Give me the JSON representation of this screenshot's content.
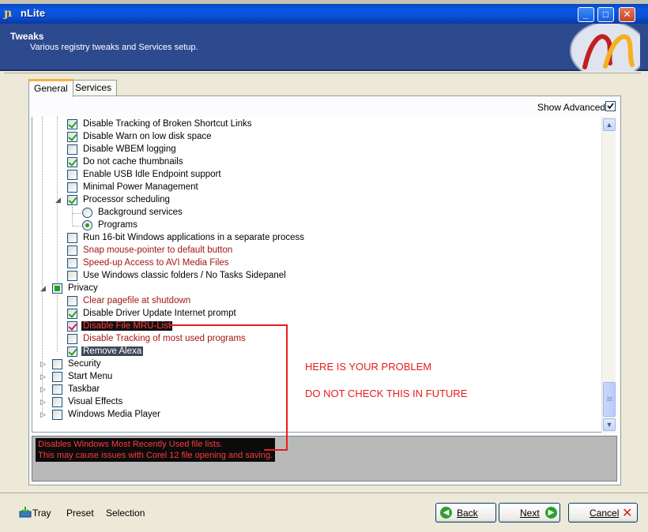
{
  "window": {
    "title": "nLite"
  },
  "header": {
    "title": "Tweaks",
    "subtitle": "Various registry tweaks and Services setup."
  },
  "tabs": [
    {
      "label": "General"
    },
    {
      "label": "Services"
    }
  ],
  "show_advanced": {
    "label": "Show Advanced",
    "checked": true
  },
  "tree_items": [
    {
      "label": "Disable Tracking of Broken Shortcut Links",
      "state": "checked"
    },
    {
      "label": "Disable Warn on low disk space",
      "state": "checked"
    },
    {
      "label": "Disable WBEM logging",
      "state": "unchecked"
    },
    {
      "label": "Do not cache thumbnails",
      "state": "checked"
    },
    {
      "label": "Enable USB Idle Endpoint support",
      "state": "unchecked"
    },
    {
      "label": "Minimal Power Management",
      "state": "unchecked"
    },
    {
      "label": "Processor scheduling",
      "state": "checked"
    },
    {
      "label": "Background services",
      "state": "radio-off"
    },
    {
      "label": "Programs",
      "state": "radio-on"
    },
    {
      "label": "Run 16-bit Windows applications in a separate process",
      "state": "unchecked"
    },
    {
      "label": "Snap mouse-pointer to default button",
      "state": "unchecked"
    },
    {
      "label": "Speed-up Access to AVI Media Files",
      "state": "unchecked"
    },
    {
      "label": "Use Windows classic folders / No Tasks Sidepanel",
      "state": "unchecked"
    },
    {
      "label": "Privacy",
      "state": "partial"
    },
    {
      "label": "Clear pagefile at shutdown",
      "state": "unchecked"
    },
    {
      "label": "Disable Driver Update Internet prompt",
      "state": "checked"
    },
    {
      "label": "Disable File MRU-List",
      "state": "checked"
    },
    {
      "label": "Disable Tracking of most used programs",
      "state": "unchecked"
    },
    {
      "label": "Remove Alexa",
      "state": "checked"
    },
    {
      "label": "Security",
      "state": "unchecked"
    },
    {
      "label": "Start Menu",
      "state": "unchecked"
    },
    {
      "label": "Taskbar",
      "state": "unchecked"
    },
    {
      "label": "Visual Effects",
      "state": "unchecked"
    },
    {
      "label": "Windows Media Player",
      "state": "unchecked"
    }
  ],
  "description": {
    "line1": "Disables Windows Most Recently Used file lists.",
    "line2": "This may cause issues with Corel 12 file opening and saving."
  },
  "annotation": {
    "line1": "HERE IS YOUR PROBLEM",
    "line2": "DO NOT CHECK THIS IN FUTURE",
    "color": "#e81b1b"
  },
  "footer": {
    "tray": "Tray",
    "preset": "Preset",
    "selection": "Selection",
    "back": "Back",
    "next": "Next",
    "cancel": "Cancel"
  },
  "colors": {
    "header_bg": "#2d4a8e",
    "title_bar": "#0a58e8",
    "check_green": "#21a121",
    "warn_text": "#a31515"
  }
}
